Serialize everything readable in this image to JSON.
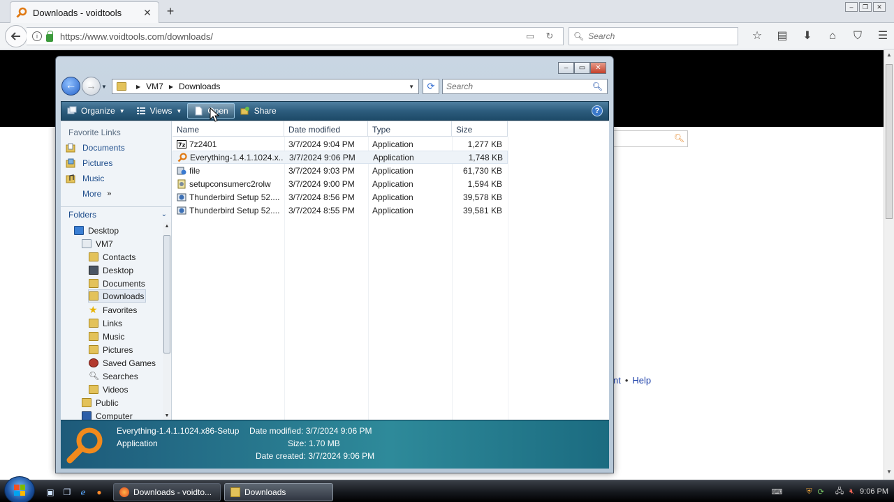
{
  "browser": {
    "tab_title": "Downloads - voidtools",
    "tab_close": "✕",
    "new_tab": "+",
    "url": "https://www.voidtools.com/downloads/",
    "search_placeholder": "Search",
    "window_buttons": [
      "‒",
      "❐",
      "✕"
    ],
    "toolbar_icons": [
      "bookmark-star-icon",
      "reading-list-icon",
      "download-icon",
      "home-icon",
      "pocket-icon",
      "menu-icon"
    ]
  },
  "page": {
    "footer_partial": "nt",
    "footer_help": "Help"
  },
  "explorer": {
    "breadcrumb": [
      "VM7",
      "Downloads"
    ],
    "search_placeholder": "Search",
    "toolbar": {
      "organize": "Organize",
      "views": "Views",
      "open": "Open",
      "share": "Share",
      "help": "?"
    },
    "favorite_links_header": "Favorite Links",
    "favorite_links": [
      {
        "label": "Documents",
        "icon": "documents-folder-icon"
      },
      {
        "label": "Pictures",
        "icon": "pictures-folder-icon"
      },
      {
        "label": "Music",
        "icon": "music-folder-icon"
      }
    ],
    "more_label": "More",
    "more_chevron": "»",
    "folders_header": "Folders",
    "tree": [
      {
        "label": "Desktop",
        "level": 0,
        "icon": "desktop-icon"
      },
      {
        "label": "VM7",
        "level": 1,
        "icon": "user-folder-icon"
      },
      {
        "label": "Contacts",
        "level": 2,
        "icon": "contacts-folder-icon"
      },
      {
        "label": "Desktop",
        "level": 2,
        "icon": "desktop-folder-icon"
      },
      {
        "label": "Documents",
        "level": 2,
        "icon": "documents-folder-icon"
      },
      {
        "label": "Downloads",
        "level": 2,
        "icon": "downloads-folder-icon",
        "selected": true
      },
      {
        "label": "Favorites",
        "level": 2,
        "icon": "favorites-star-icon"
      },
      {
        "label": "Links",
        "level": 2,
        "icon": "links-folder-icon"
      },
      {
        "label": "Music",
        "level": 2,
        "icon": "music-folder-icon"
      },
      {
        "label": "Pictures",
        "level": 2,
        "icon": "pictures-folder-icon"
      },
      {
        "label": "Saved Games",
        "level": 2,
        "icon": "saved-games-icon"
      },
      {
        "label": "Searches",
        "level": 2,
        "icon": "searches-icon"
      },
      {
        "label": "Videos",
        "level": 2,
        "icon": "videos-folder-icon"
      },
      {
        "label": "Public",
        "level": 1,
        "icon": "public-folder-icon"
      },
      {
        "label": "Computer",
        "level": 1,
        "icon": "computer-icon"
      }
    ],
    "columns": [
      "Name",
      "Date modified",
      "Type",
      "Size"
    ],
    "files": [
      {
        "name": "7z2401",
        "modified": "3/7/2024 9:04 PM",
        "type": "Application",
        "size": "1,277 KB",
        "icon": "7zip-icon"
      },
      {
        "name": "Everything-1.4.1.1024.x...",
        "modified": "3/7/2024 9:06 PM",
        "type": "Application",
        "size": "1,748 KB",
        "icon": "everything-search-icon",
        "selected": true
      },
      {
        "name": "file",
        "modified": "3/7/2024 9:03 PM",
        "type": "Application",
        "size": "61,730 KB",
        "icon": "installer-icon"
      },
      {
        "name": "setupconsumerc2rolw",
        "modified": "3/7/2024 9:00 PM",
        "type": "Application",
        "size": "1,594 KB",
        "icon": "office-setup-icon"
      },
      {
        "name": "Thunderbird Setup 52....",
        "modified": "3/7/2024 8:56 PM",
        "type": "Application",
        "size": "39,578 KB",
        "icon": "thunderbird-icon"
      },
      {
        "name": "Thunderbird Setup 52....",
        "modified": "3/7/2024 8:55 PM",
        "type": "Application",
        "size": "39,581 KB",
        "icon": "thunderbird-icon"
      }
    ],
    "details": {
      "name": "Everything-1.4.1.1024.x86-Setup",
      "type": "Application",
      "date_modified_label": "Date modified:",
      "date_modified": "3/7/2024 9:06 PM",
      "size_label": "Size:",
      "size": "1.70 MB",
      "date_created_label": "Date created:",
      "date_created": "3/7/2024 9:06 PM"
    }
  },
  "taskbar": {
    "tasks": [
      {
        "label": "Downloads - voidto...",
        "icon": "firefox-icon"
      },
      {
        "label": "Downloads",
        "icon": "folder-icon",
        "active": true
      }
    ],
    "clock": "9:06 PM"
  },
  "colors": {
    "explorer_toolbar": "#2d5d7e",
    "details_pane": "#2e8a9a",
    "link_blue": "#1f4e8c",
    "accent_orange": "#e07a14"
  }
}
